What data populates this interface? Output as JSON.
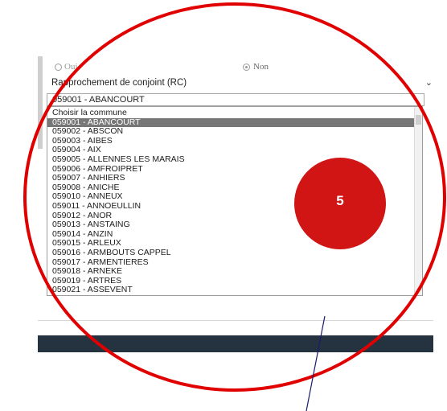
{
  "radio": {
    "oui_label": "Oui",
    "non_label": "Non",
    "selected": "Non"
  },
  "motif_select": {
    "value": "Rapprochement de conjoint (RC)"
  },
  "commune_select": {
    "value": "059001 - ABANCOURT"
  },
  "commune_list": {
    "items": [
      "Choisir la commune",
      "059001 - ABANCOURT",
      "059002 - ABSCON",
      "059003 - AIBES",
      "059004 - AIX",
      "059005 - ALLENNES LES MARAIS",
      "059006 - AMFROIPRET",
      "059007 - ANHIERS",
      "059008 - ANICHE",
      "059010 - ANNEUX",
      "059011 - ANNOEULLIN",
      "059012 - ANOR",
      "059013 - ANSTAING",
      "059014 - ANZIN",
      "059015 - ARLEUX",
      "059016 - ARMBOUTS CAPPEL",
      "059017 - ARMENTIERES",
      "059018 - ARNEKE",
      "059019 - ARTRES",
      "059021 - ASSEVENT"
    ],
    "selected_index": 1
  },
  "annotation": {
    "badge_number": "5",
    "highlight_color": "#e10000",
    "badge_color": "#d11414"
  }
}
